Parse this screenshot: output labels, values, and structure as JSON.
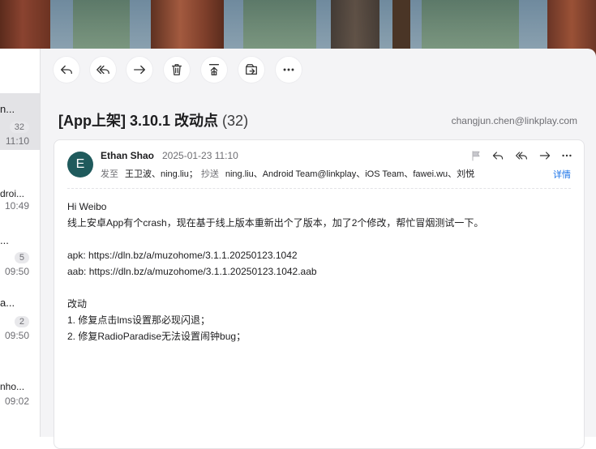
{
  "list": {
    "items": [
      {
        "title": "n...",
        "count": "32",
        "time": "11:10",
        "selected": true
      },
      {
        "title": "droi...",
        "count": "",
        "time": "10:49",
        "selected": false
      },
      {
        "title": "...",
        "count": "5",
        "time": "09:50",
        "selected": false
      },
      {
        "title": "a...",
        "count": "2",
        "time": "09:50",
        "selected": false
      },
      {
        "title": "nho...",
        "count": "",
        "time": "09:02",
        "selected": false
      }
    ]
  },
  "toolbar": {
    "buttons": [
      "reply-icon",
      "reply-all-icon",
      "forward-icon",
      "trash-icon",
      "archive-up-icon",
      "move-to-icon",
      "more-icon"
    ]
  },
  "email": {
    "subject": "[App上架] 3.10.1 改动点",
    "count": "(32)",
    "account": "changjun.chen@linkplay.com",
    "avatar_letter": "E",
    "avatar_color": "#1f5a5c",
    "sender": "Ethan Shao",
    "date": "2025-01-23 11:10",
    "to_label": "发至",
    "to": "王卫波、ning.liu；",
    "cc_label": "抄送",
    "cc": "ning.liu、Android Team@linkplay、iOS Team、fawei.wu、刘悦",
    "detail_label": "详情",
    "body": [
      "Hi Weibo",
      "线上安卓App有个crash，现在基于线上版本重新出个了版本，加了2个修改，帮忙冒烟测试一下。",
      "",
      "apk: https://dln.bz/a/muzohome/3.1.1.20250123.1042",
      "aab: https://dln.bz/a/muzohome/3.1.1.20250123.1042.aab",
      "",
      "改动",
      "1. 修复点击lms设置那必现闪退；",
      "2. 修复RadioParadise无法设置闹钟bug；"
    ]
  },
  "colors": {
    "accent": "#1a73e8",
    "selected_row": "#e3e3e6"
  }
}
